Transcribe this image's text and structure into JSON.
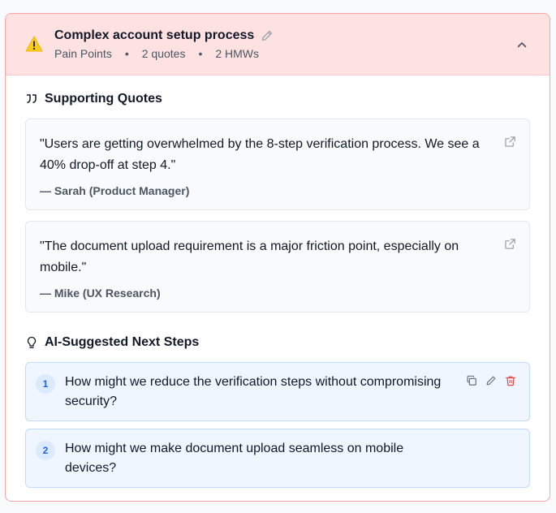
{
  "header": {
    "title": "Complex account setup process",
    "category": "Pain Points",
    "quotes_count": "2 quotes",
    "hmws_count": "2 HMWs",
    "separator": "•",
    "accent_color": "#fee2e2"
  },
  "quotes_section": {
    "title": "Supporting Quotes",
    "quotes": [
      {
        "text": "\"Users are getting overwhelmed by the 8-step verification process. We see a 40% drop-off at step 4.\"",
        "author": "— Sarah (Product Manager)"
      },
      {
        "text": "\"The document upload requirement is a major friction point, especially on mobile.\"",
        "author": "— Mike (UX Research)"
      }
    ]
  },
  "next_steps_section": {
    "title": "AI-Suggested Next Steps",
    "items": [
      {
        "number": "1",
        "text": "How might we reduce the verification steps without compromising security?"
      },
      {
        "number": "2",
        "text": "How might we make document upload seamless on mobile devices?"
      }
    ]
  }
}
